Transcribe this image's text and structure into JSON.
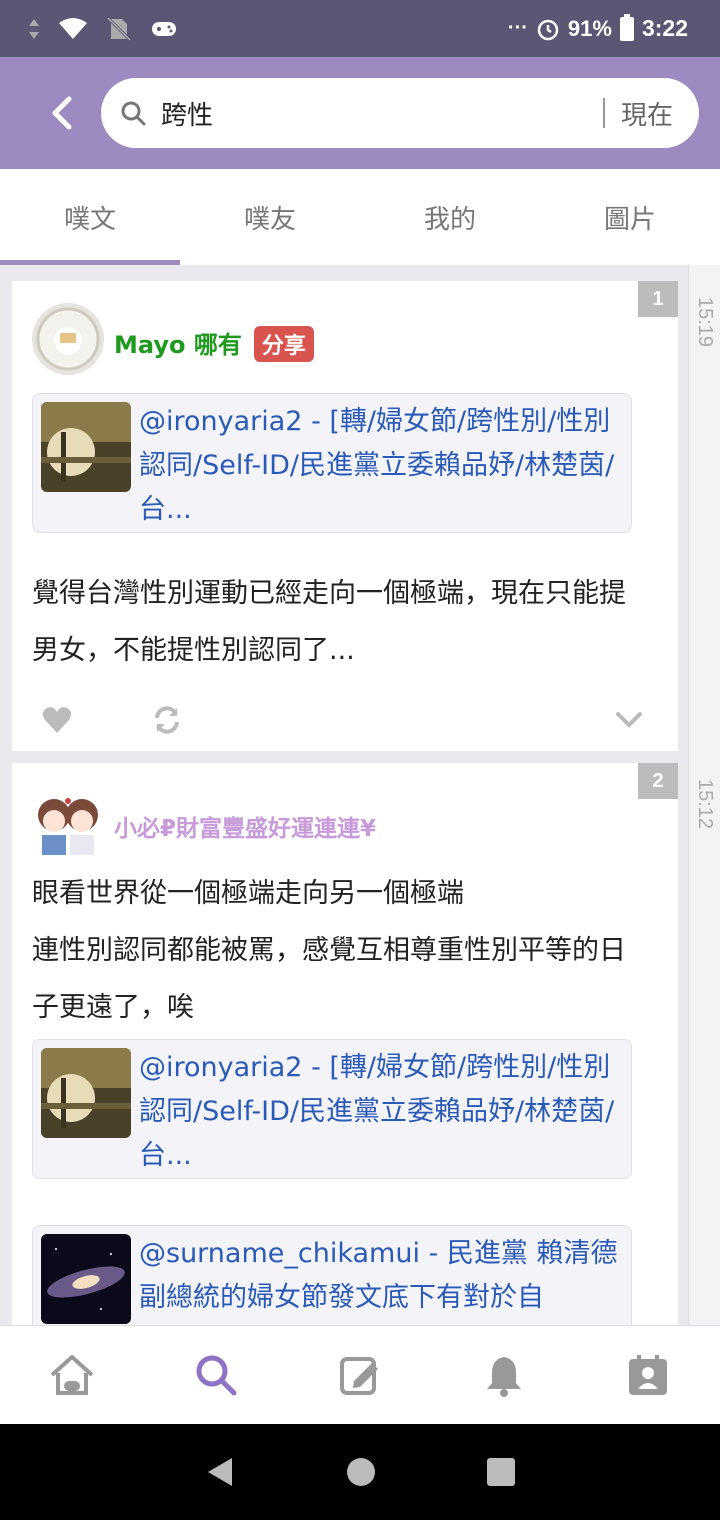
{
  "status_bar": {
    "battery": "91%",
    "time": "3:22",
    "overflow": "···"
  },
  "search": {
    "query": "跨性",
    "filter_label": "現在"
  },
  "tabs": [
    {
      "label": "噗文",
      "active": true
    },
    {
      "label": "噗友",
      "active": false
    },
    {
      "label": "我的",
      "active": false
    },
    {
      "label": "圖片",
      "active": false
    }
  ],
  "posts": [
    {
      "number": "1",
      "time": "15:19",
      "author": "Mayo 哪有",
      "author_color": "#1f9a1f",
      "badge": "分享",
      "link": "@ironyaria2 - [轉/婦女節/跨性別/性別認同/Self-ID/民進黨立委賴品妤/林楚茵/台...",
      "text": "覺得台灣性別運動已經走向一個極端，現在只能提男女，不能提性別認同了..."
    },
    {
      "number": "2",
      "time": "15:12",
      "author": "小必₽財富豐盛好運連連¥",
      "author_color": "#c79ad9",
      "text_line1": "眼看世界從一個極端走向另一個極端",
      "text_line2": "連性別認同都能被罵，感覺互相尊重性別平等的日子更遠了，唉",
      "link": "@ironyaria2 - [轉/婦女節/跨性別/性別認同/Self-ID/民進黨立委賴品妤/林楚茵/台...",
      "link2": "@surname_chikamui - 民進黨 賴清德副總統的婦女節發文底下有對於自"
    }
  ],
  "colors": {
    "header": "#9d8ac0",
    "statusbar": "#595773",
    "link": "#2a5ab8"
  }
}
